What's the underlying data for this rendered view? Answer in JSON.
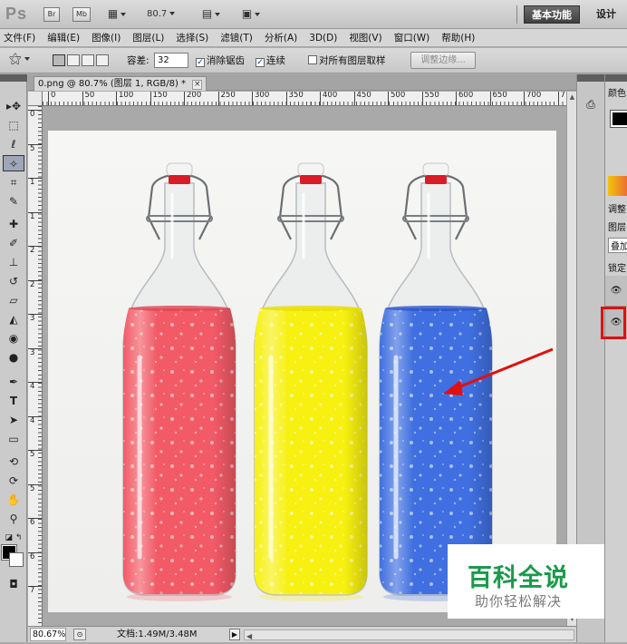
{
  "app": {
    "logo": "Ps",
    "bridge_label": "Br",
    "minibridge_label": "Mb",
    "zoom_value": "80.7",
    "workspace_label": "基本功能",
    "design_label": "设计"
  },
  "menu": [
    "文件(F)",
    "编辑(E)",
    "图像(I)",
    "图层(L)",
    "选择(S)",
    "滤镜(T)",
    "分析(A)",
    "3D(D)",
    "视图(V)",
    "窗口(W)",
    "帮助(H)"
  ],
  "options": {
    "tolerance_label": "容差:",
    "tolerance_value": "32",
    "antialias_label": "消除锯齿",
    "antialias_checked": true,
    "contiguous_label": "连续",
    "contiguous_checked": true,
    "sample_all_label": "对所有图层取样",
    "sample_all_checked": false,
    "refine_edge_label": "调整边缘..."
  },
  "document": {
    "tab_title": "0.png @ 80.7% (图层 1, RGB/8) *",
    "close_glyph": "×"
  },
  "ruler": {
    "h_labels": [
      "0",
      "50",
      "100",
      "150",
      "200",
      "250",
      "300",
      "350",
      "400",
      "450",
      "500",
      "550",
      "600",
      "650",
      "700",
      "7"
    ],
    "v_labels": [
      "0",
      "5",
      "1",
      "1",
      "2",
      "2",
      "3",
      "3",
      "4",
      "4",
      "5",
      "5",
      "6",
      "6",
      "7"
    ]
  },
  "status": {
    "zoom": "80.67%",
    "doc_info": "文档:1.49M/3.48M",
    "arrow": "▶"
  },
  "right_panel": {
    "color_tab": "颜色",
    "adjust_tab": "调整",
    "layers_tab": "图层",
    "blend_mode": "叠加",
    "lock_label": "锁定"
  },
  "watermark": {
    "title": "百科全说",
    "subtitle": "助你轻松解决"
  },
  "bottles": [
    {
      "liquid": "#f25a66",
      "liquid_dark": "#e04552"
    },
    {
      "liquid": "#f7f010",
      "liquid_dark": "#e8dc00"
    },
    {
      "liquid": "#3f6fe0",
      "liquid_dark": "#2a55c8"
    }
  ],
  "colors": {
    "annotation_red": "#e01010",
    "cap_red": "#d81c28",
    "watermark_green": "#1a9a4a"
  },
  "icons": {
    "move": "move-tool-icon",
    "marquee": "marquee-tool-icon",
    "lasso": "lasso-tool-icon",
    "quick_select": "quick-select-tool-icon",
    "crop": "crop-tool-icon",
    "eyedropper": "eyedropper-tool-icon",
    "heal": "healing-brush-icon",
    "brush": "brush-tool-icon",
    "stamp": "clone-stamp-icon",
    "history_brush": "history-brush-icon",
    "eraser": "eraser-tool-icon",
    "bucket": "paint-bucket-icon",
    "blur": "blur-tool-icon",
    "dodge": "dodge-tool-icon",
    "pen": "pen-tool-icon",
    "type": "type-tool-icon",
    "path_select": "path-select-icon",
    "shape": "shape-tool-icon",
    "rotate3d": "3d-rotate-icon",
    "orbit3d": "3d-orbit-icon",
    "hand": "hand-tool-icon",
    "zoom": "zoom-tool-icon",
    "eye": "eye-icon"
  }
}
